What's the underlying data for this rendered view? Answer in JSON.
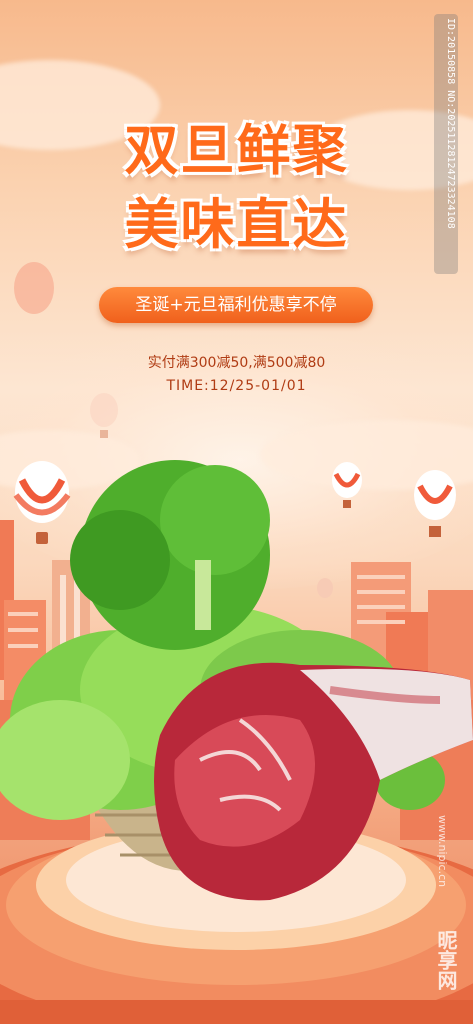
{
  "poster": {
    "title_line1": "双旦鲜聚",
    "title_line2": "美味直达",
    "subtitle": "圣诞+元旦福利优惠享不停",
    "offer": "实付满300减50,满500减80",
    "time": "TIME:12/25-01/01"
  },
  "watermark": {
    "id_text": "ID:20150858 NO:20251128124723324108",
    "site": "www.nipic.cn",
    "logo_text": "昵享网"
  },
  "colors": {
    "title": "#ff6a1a",
    "pill": "#f0601c",
    "offer_text": "#b03c14",
    "stage": "#f07a4a"
  },
  "icons": [
    "hot-air-balloon-icon",
    "lettuce-basket-illustration",
    "lamb-leg-illustration",
    "buildings-illustration",
    "podium-illustration"
  ]
}
